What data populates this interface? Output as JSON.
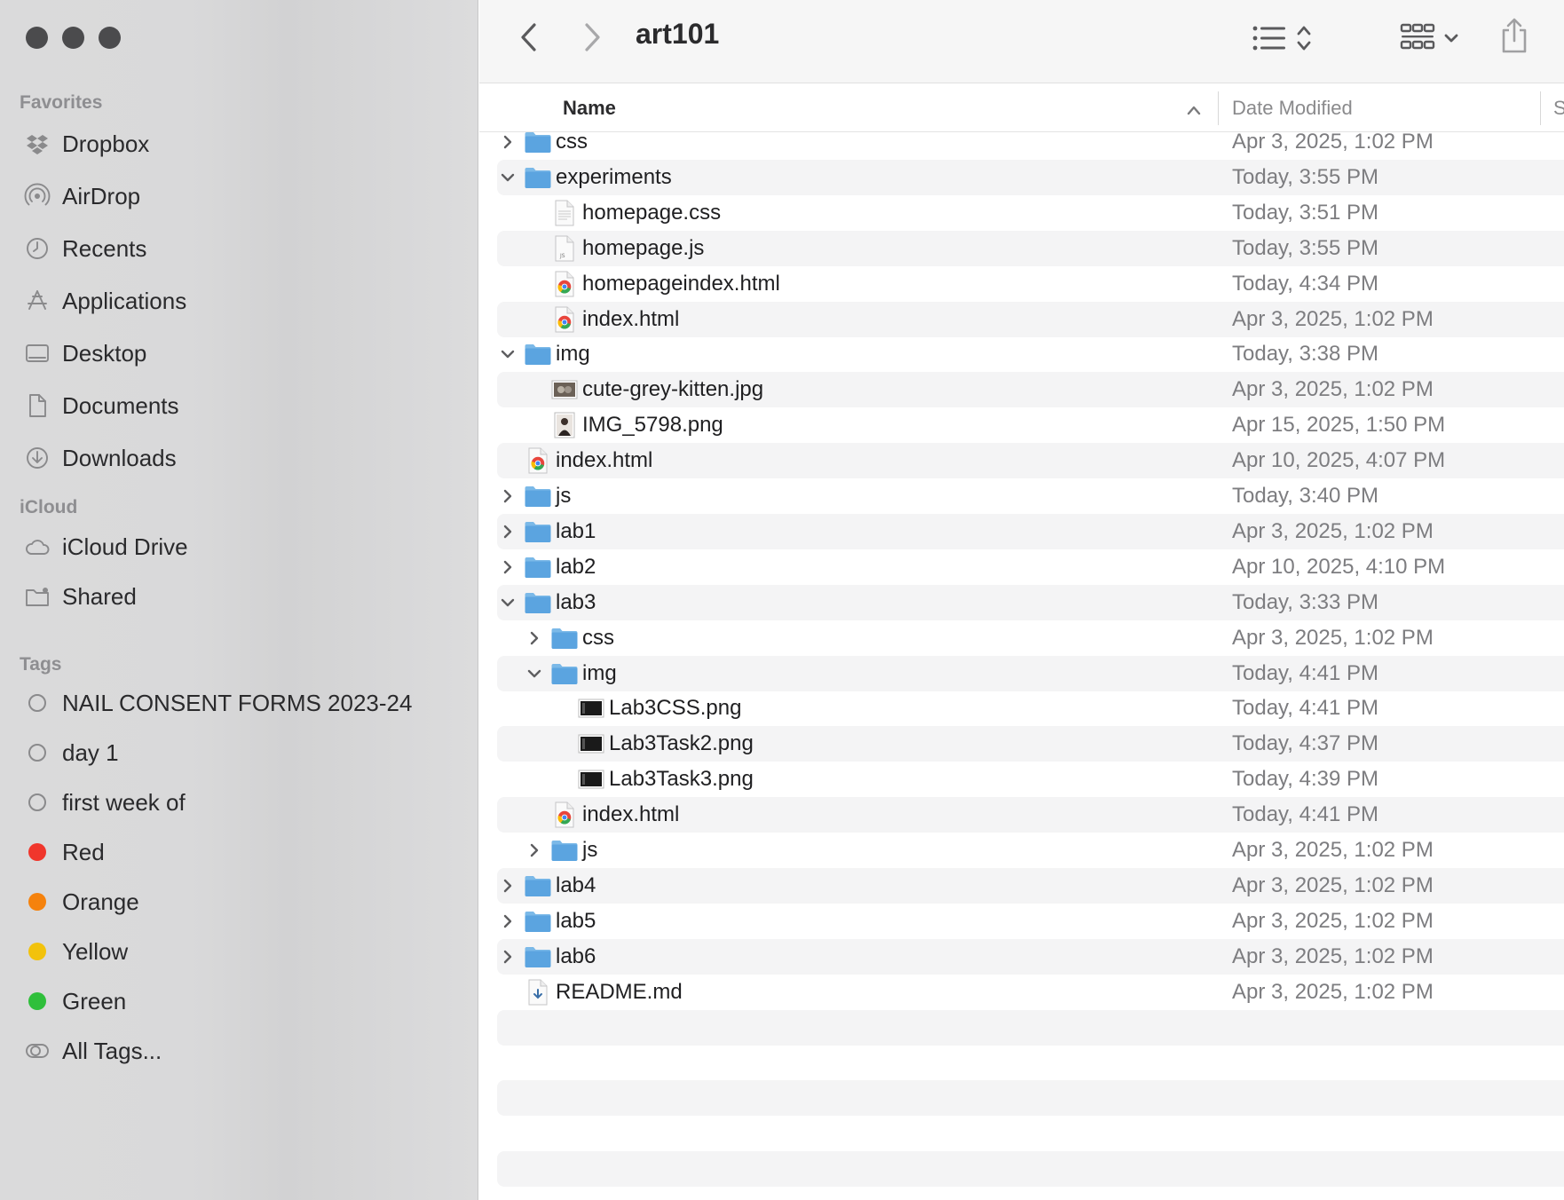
{
  "window": {
    "title": "art101"
  },
  "sidebar": {
    "favorites_title": "Favorites",
    "favorites": [
      {
        "label": "Dropbox",
        "icon": "dropbox-icon"
      },
      {
        "label": "AirDrop",
        "icon": "airdrop-icon"
      },
      {
        "label": "Recents",
        "icon": "clock-icon"
      },
      {
        "label": "Applications",
        "icon": "applications-icon"
      },
      {
        "label": "Desktop",
        "icon": "desktop-icon"
      },
      {
        "label": "Documents",
        "icon": "document-icon"
      },
      {
        "label": "Downloads",
        "icon": "download-icon"
      }
    ],
    "icloud_title": "iCloud",
    "icloud": [
      {
        "label": "iCloud Drive",
        "icon": "cloud-icon"
      },
      {
        "label": "Shared",
        "icon": "shared-folder-icon"
      }
    ],
    "tags_title": "Tags",
    "tags": [
      {
        "label": "NAIL CONSENT FORMS 2023-24",
        "color": ""
      },
      {
        "label": "day 1",
        "color": ""
      },
      {
        "label": "first week of",
        "color": ""
      },
      {
        "label": "Red",
        "color": "#f0362c"
      },
      {
        "label": "Orange",
        "color": "#f5820d"
      },
      {
        "label": "Yellow",
        "color": "#f2c20c"
      },
      {
        "label": "Green",
        "color": "#2fbf3b"
      },
      {
        "label": "All Tags...",
        "color": ""
      }
    ]
  },
  "columns": {
    "name": "Name",
    "date": "Date Modified",
    "size": "S"
  },
  "files": [
    {
      "name": "css",
      "date": "Apr 3, 2025, 1:02 PM",
      "type": "folder",
      "depth": 0,
      "expanded": false
    },
    {
      "name": "experiments",
      "date": "Today, 3:55 PM",
      "type": "folder",
      "depth": 0,
      "expanded": true
    },
    {
      "name": "homepage.css",
      "date": "Today, 3:51 PM",
      "type": "css",
      "depth": 1
    },
    {
      "name": "homepage.js",
      "date": "Today, 3:55 PM",
      "type": "js",
      "depth": 1
    },
    {
      "name": "homepageindex.html",
      "date": "Today, 4:34 PM",
      "type": "html",
      "depth": 1
    },
    {
      "name": "index.html",
      "date": "Apr 3, 2025, 1:02 PM",
      "type": "html",
      "depth": 1
    },
    {
      "name": "img",
      "date": "Today, 3:38 PM",
      "type": "folder",
      "depth": 0,
      "expanded": true
    },
    {
      "name": "cute-grey-kitten.jpg",
      "date": "Apr 3, 2025, 1:02 PM",
      "type": "photo",
      "depth": 1
    },
    {
      "name": "IMG_5798.png",
      "date": "Apr 15, 2025, 1:50 PM",
      "type": "portrait",
      "depth": 1
    },
    {
      "name": "index.html",
      "date": "Apr 10, 2025, 4:07 PM",
      "type": "html",
      "depth": 0
    },
    {
      "name": "js",
      "date": "Today, 3:40 PM",
      "type": "folder",
      "depth": 0,
      "expanded": false
    },
    {
      "name": "lab1",
      "date": "Apr 3, 2025, 1:02 PM",
      "type": "folder",
      "depth": 0,
      "expanded": false
    },
    {
      "name": "lab2",
      "date": "Apr 10, 2025, 4:10 PM",
      "type": "folder",
      "depth": 0,
      "expanded": false
    },
    {
      "name": "lab3",
      "date": "Today, 3:33 PM",
      "type": "folder",
      "depth": 0,
      "expanded": true
    },
    {
      "name": "css",
      "date": "Apr 3, 2025, 1:02 PM",
      "type": "folder",
      "depth": 1,
      "expanded": false
    },
    {
      "name": "img",
      "date": "Today, 4:41 PM",
      "type": "folder",
      "depth": 1,
      "expanded": true
    },
    {
      "name": "Lab3CSS.png",
      "date": "Today, 4:41 PM",
      "type": "screenshot",
      "depth": 2
    },
    {
      "name": "Lab3Task2.png",
      "date": "Today, 4:37 PM",
      "type": "screenshot",
      "depth": 2
    },
    {
      "name": "Lab3Task3.png",
      "date": "Today, 4:39 PM",
      "type": "screenshot",
      "depth": 2
    },
    {
      "name": "index.html",
      "date": "Today, 4:41 PM",
      "type": "html",
      "depth": 1
    },
    {
      "name": "js",
      "date": "Apr 3, 2025, 1:02 PM",
      "type": "folder",
      "depth": 1,
      "expanded": false
    },
    {
      "name": "lab4",
      "date": "Apr 3, 2025, 1:02 PM",
      "type": "folder",
      "depth": 0,
      "expanded": false
    },
    {
      "name": "lab5",
      "date": "Apr 3, 2025, 1:02 PM",
      "type": "folder",
      "depth": 0,
      "expanded": false
    },
    {
      "name": "lab6",
      "date": "Apr 3, 2025, 1:02 PM",
      "type": "folder",
      "depth": 0,
      "expanded": false
    },
    {
      "name": "README.md",
      "date": "Apr 3, 2025, 1:02 PM",
      "type": "markdown",
      "depth": 0
    }
  ]
}
